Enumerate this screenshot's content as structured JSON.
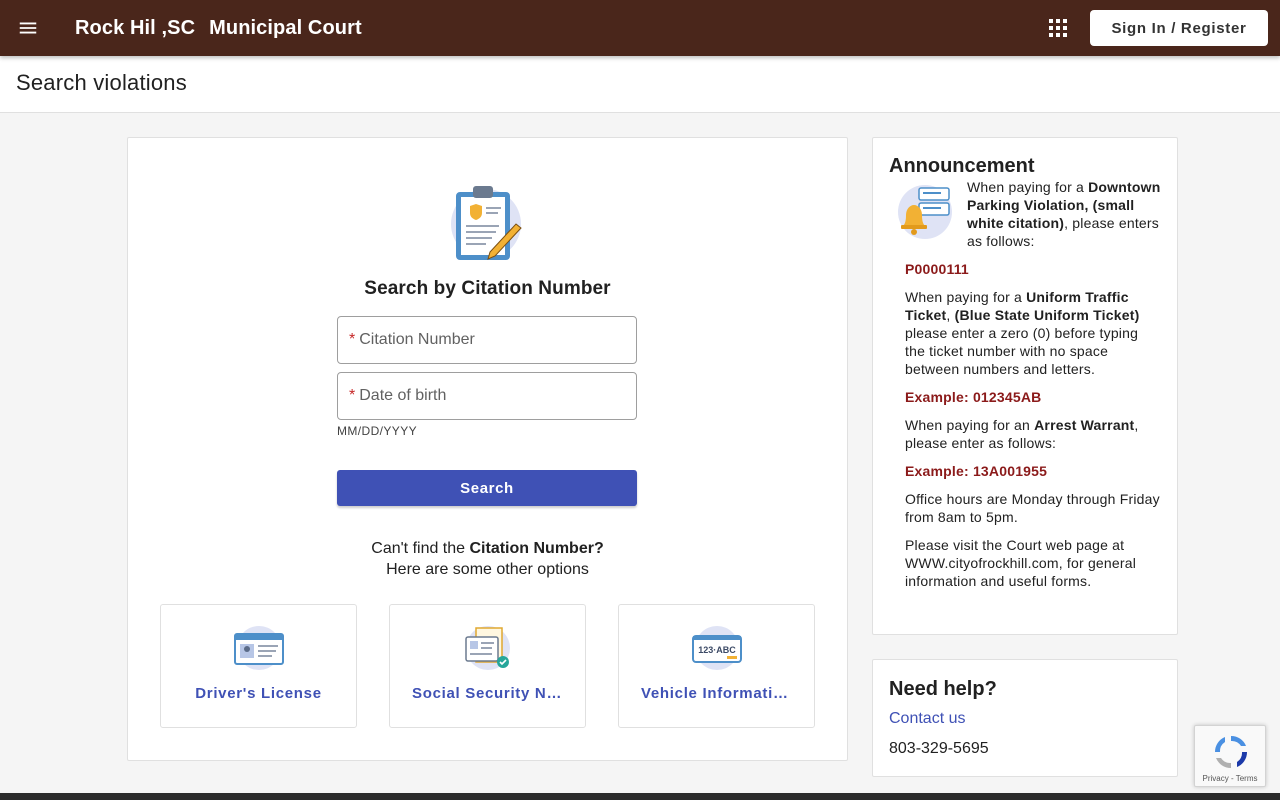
{
  "header": {
    "title_part1": "Rock Hil ,SC",
    "title_part2": "Municipal Court",
    "signin_label": "Sign In / Register",
    "bg_color": "#4a261b"
  },
  "page": {
    "title": "Search violations"
  },
  "search": {
    "heading": "Search by Citation Number",
    "citation_placeholder": "Citation Number",
    "dob_placeholder": "Date of birth",
    "required_mark": "*",
    "dob_hint": "MM/DD/YYYY",
    "button_label": "Search",
    "accent_color": "#3f51b5"
  },
  "alternatives": {
    "line1_prefix": "Can't find the ",
    "line1_bold": "Citation Number?",
    "line2": "Here are some other options",
    "options": [
      {
        "label": "Driver's License",
        "icon": "id-card-icon"
      },
      {
        "label": "Social Security Nu…",
        "icon": "ssn-card-icon"
      },
      {
        "label": "Vehicle Information",
        "icon": "license-plate-icon"
      }
    ]
  },
  "announcement": {
    "title": "Announcement",
    "p1_text1": "When paying for a ",
    "p1_bold": "Downtown Parking Violation, (small white citation)",
    "p1_text2": ", please enters as follows:",
    "code1": "P0000111",
    "p2_text1": "When paying for a ",
    "p2_bold1": "Uniform Traffic Ticket",
    "p2_text2": ", ",
    "p2_bold2": "(Blue State Uniform Ticket)",
    "p2_text3": " please enter a zero (0) before typing the ticket number with no space between numbers and letters.",
    "code2": "Example: 012345AB",
    "p3_text1": "When paying for an ",
    "p3_bold": "Arrest Warrant",
    "p3_text2": ", please enter as follows:",
    "code3": "Example: 13A001955",
    "p4": "Office hours are Monday through Friday from 8am to 5pm.",
    "p5": "Please visit the Court web page at WWW.cityofrockhill.com, for general information and useful forms."
  },
  "help": {
    "title": "Need help?",
    "link": "Contact us",
    "phone": "803-329-5695"
  },
  "recaptcha": {
    "links": "Privacy - Terms"
  }
}
